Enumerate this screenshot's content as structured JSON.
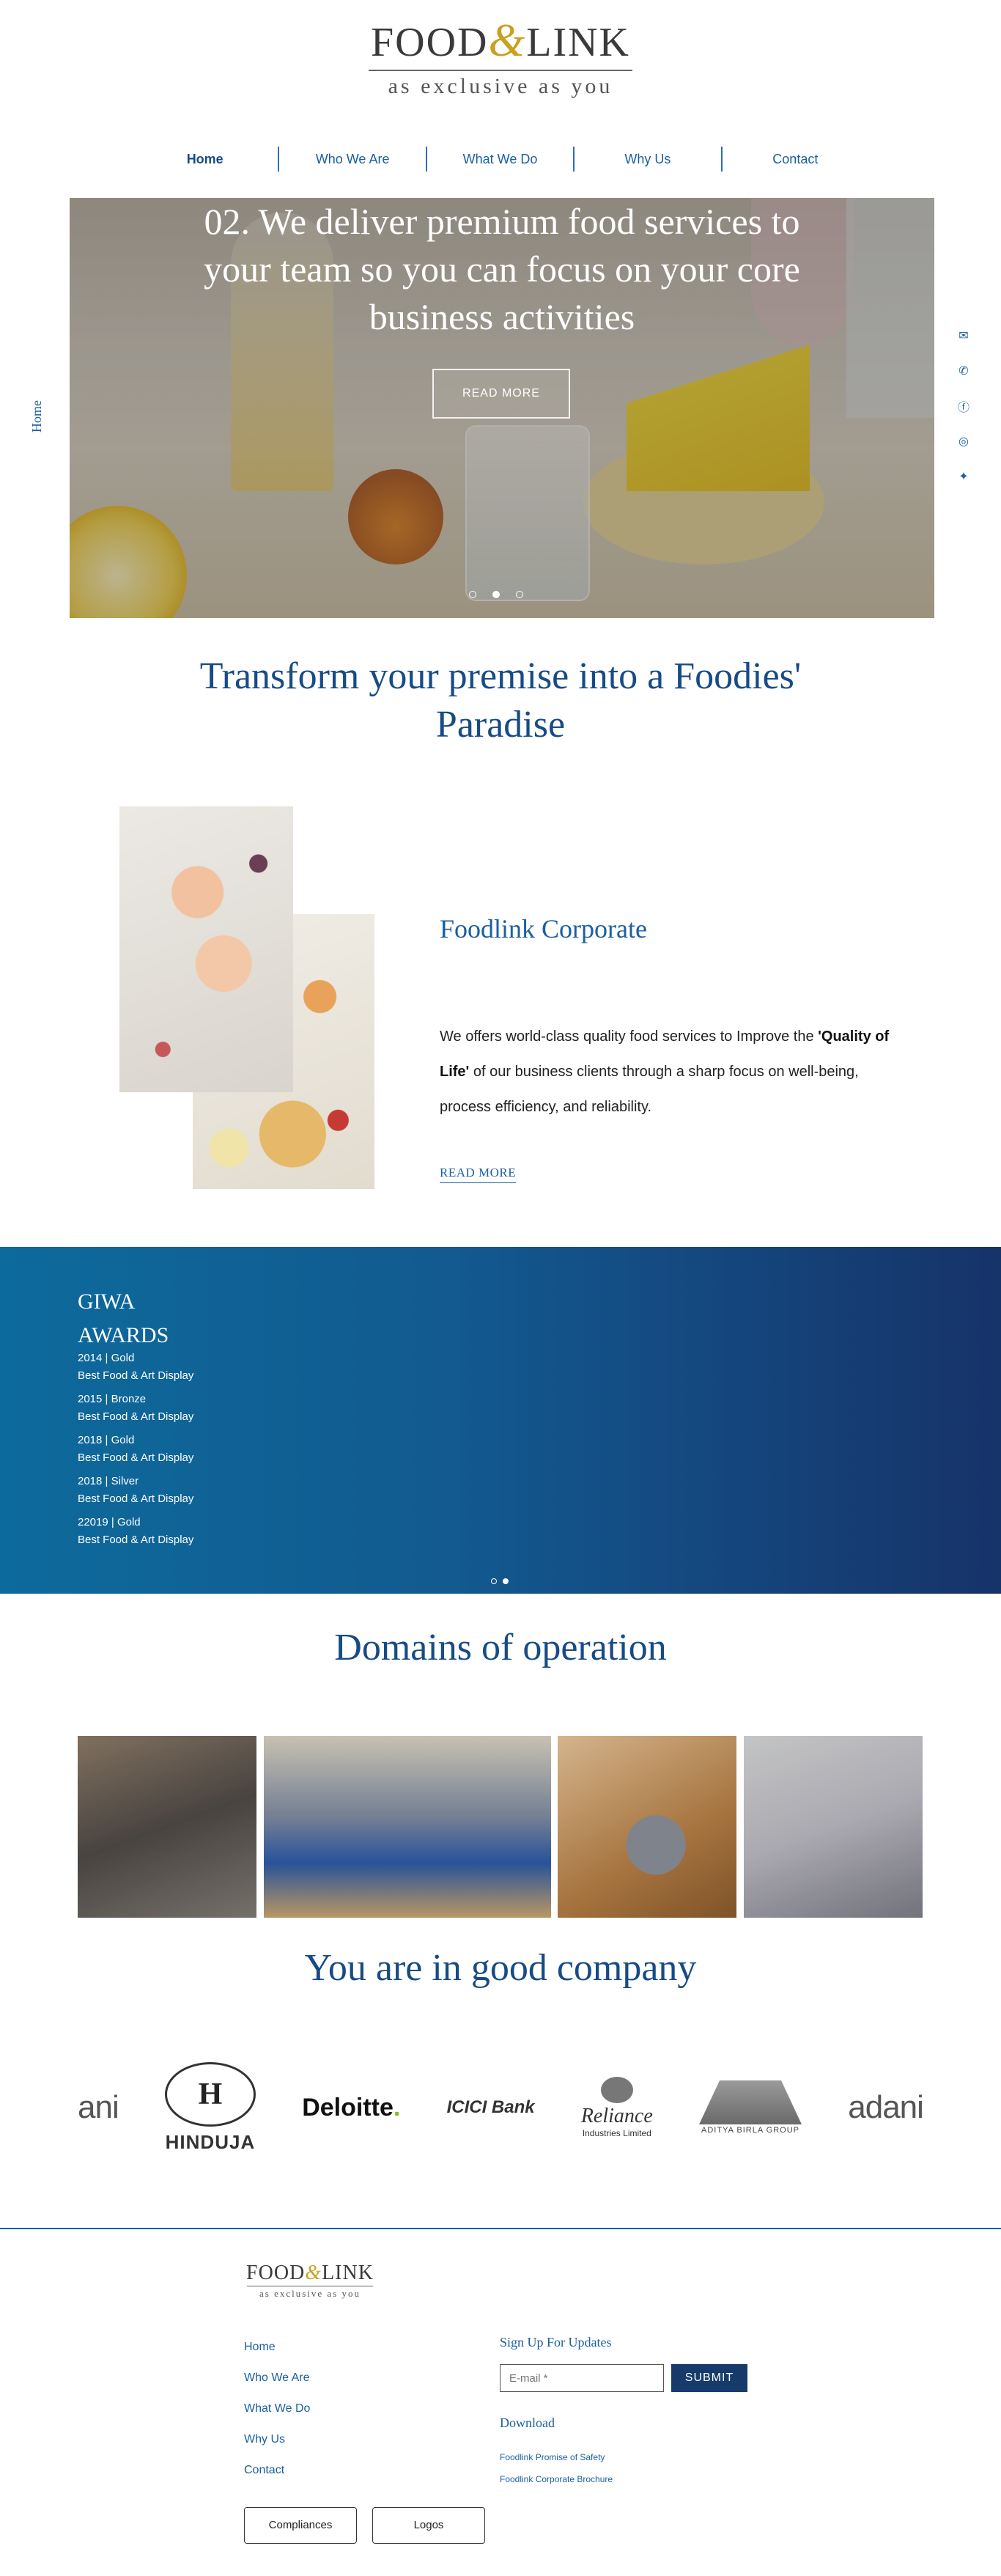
{
  "header": {
    "brand_left": "FOOD",
    "brand_amp": "&",
    "brand_right": "LINK",
    "tagline": "as exclusive as you"
  },
  "nav": {
    "items": [
      {
        "label": "Home"
      },
      {
        "label": "Who We Are"
      },
      {
        "label": "What We Do"
      },
      {
        "label": "Why Us"
      },
      {
        "label": "Contact"
      }
    ]
  },
  "side": {
    "label": "Home"
  },
  "social": {
    "icons": [
      "email-icon",
      "phone-icon",
      "facebook-icon",
      "instagram-icon",
      "twitter-icon"
    ],
    "glyphs": [
      "✉",
      "✆",
      "ⓕ",
      "◎",
      "✦"
    ]
  },
  "hero": {
    "title": "02. We deliver premium food services to your team so you can focus on your core business activities",
    "button_label": "READ MORE",
    "slide_count": 3,
    "active_slide": 2
  },
  "transform": {
    "title": "Transform your premise into a Foodies' Paradise"
  },
  "corporate": {
    "title": "Foodlink Corporate",
    "text_before": "We offers world-class quality food services to Improve the ",
    "text_bold": "'Quality of Life'",
    "text_after": " of our business clients through a sharp focus on well-being, process efficiency, and reliability.",
    "more_label": "READ MORE"
  },
  "awards": {
    "title": "GIWA AWARDS",
    "items": [
      {
        "year_medal": "2014 | Gold",
        "category": "Best Food & Art Display"
      },
      {
        "year_medal": "2015 | Bronze",
        "category": "Best Food & Art Display"
      },
      {
        "year_medal": "2018 | Gold",
        "category": "Best Food & Art Display"
      },
      {
        "year_medal": "2018 | Silver",
        "category": "Best Food & Art Display"
      },
      {
        "year_medal": "22019 | Gold",
        "category": "Best Food & Art Display"
      }
    ]
  },
  "domains": {
    "title": "Domains of operation"
  },
  "company": {
    "title": "You are in good company",
    "logos": {
      "adani_partial": "ani",
      "hinduja_mark": "H",
      "hinduja": "HINDUJA",
      "deloitte": "Deloitte",
      "icici": "ICICI Bank",
      "reliance": "Reliance",
      "reliance_sub": "Industries Limited",
      "aditya": "ADITYA BIRLA GROUP",
      "adani": "adani"
    }
  },
  "footer": {
    "brand_left": "FOOD",
    "brand_amp": "&",
    "brand_right": "LINK",
    "tagline": "as exclusive as you",
    "links": [
      "Home",
      "Who We Are",
      "What We Do",
      "Why Us",
      "Contact"
    ],
    "signup_title": "Sign Up For Updates",
    "email_placeholder": "E-mail *",
    "submit_label": "SUBMIT",
    "download_title": "Download",
    "downloads": [
      "Foodlink Promise of Safety",
      "Foodlink Corporate Brochure"
    ],
    "buttons": [
      "Compliances",
      "Logos"
    ]
  }
}
